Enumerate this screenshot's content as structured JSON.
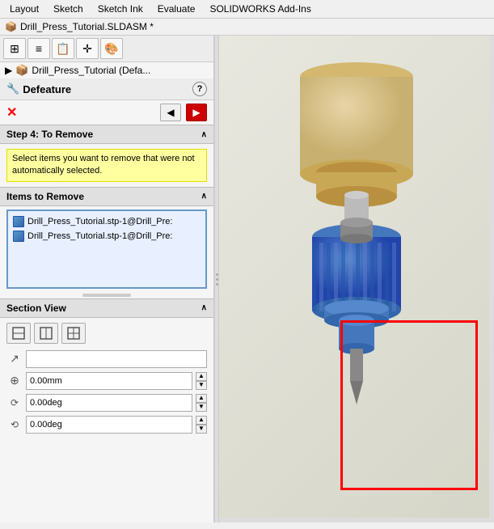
{
  "menubar": {
    "items": [
      "Layout",
      "Sketch",
      "Sketch Ink",
      "Evaluate",
      "SOLIDWORKS Add-Ins"
    ]
  },
  "titlebar": {
    "icon": "📦",
    "title": "Drill_Press_Tutorial.SLDASM *"
  },
  "toolbar": {
    "buttons": [
      {
        "icon": "⊞",
        "label": "feature-tree-btn"
      },
      {
        "icon": "≡",
        "label": "property-btn"
      },
      {
        "icon": "📋",
        "label": "config-btn"
      },
      {
        "icon": "✛",
        "label": "reference-btn"
      },
      {
        "icon": "🎨",
        "label": "appearance-btn"
      }
    ]
  },
  "tree": {
    "expand_arrow": "▶",
    "label": "Drill_Press_Tutorial (Defa..."
  },
  "defeature": {
    "title": "Defeature",
    "help_label": "?",
    "close_label": "✕",
    "back_arrow": "◀",
    "forward_arrow": "▶"
  },
  "step4": {
    "section_label": "Step 4: To Remove",
    "chevron": "∧",
    "info_text": "Select items you want to remove that were not automatically selected."
  },
  "items_to_remove": {
    "section_label": "Items to Remove",
    "chevron": "∧",
    "item1": "Drill_Press_Tutorial.stp-1@Drill_Pre:",
    "item2": "Drill_Press_Tutorial.stp-1@Drill_Pre:"
  },
  "section_view": {
    "section_label": "Section View",
    "chevron": "∧",
    "buttons": [
      "↙",
      "↔",
      "↗"
    ],
    "arrow_icon": "↗",
    "fields": [
      {
        "icon": "⊕",
        "value": "0.00mm",
        "label": "offset-field"
      },
      {
        "icon": "⟳",
        "value": "0.00deg",
        "label": "x-rotation-field"
      },
      {
        "icon": "⟲",
        "value": "0.00deg",
        "label": "y-rotation-field"
      }
    ]
  },
  "colors": {
    "accent_red": "#cc0000",
    "selection_border": "#ff0000",
    "info_bg": "#ffffa0",
    "list_border": "#6699cc",
    "list_bg": "#e8f0ff"
  }
}
